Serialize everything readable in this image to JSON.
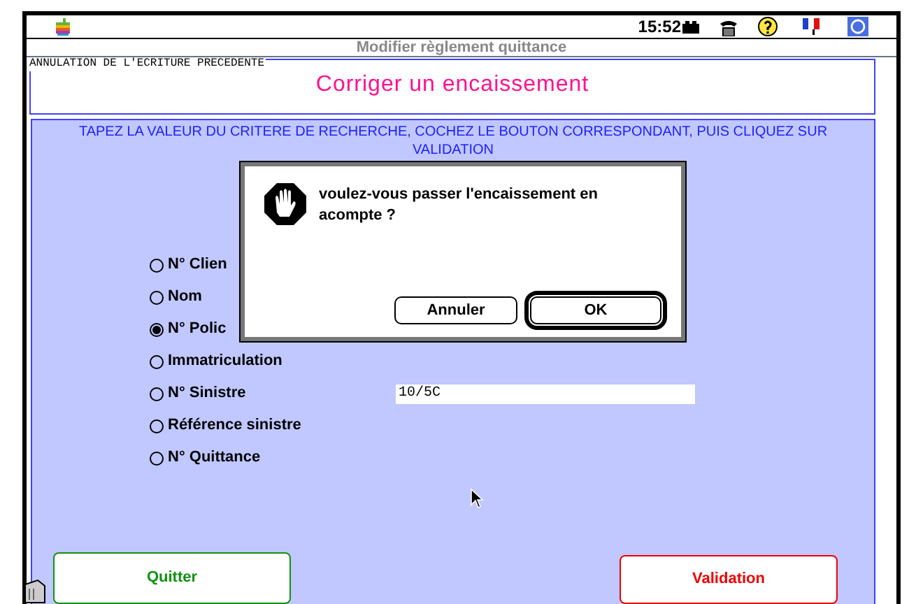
{
  "menu_bar": {
    "time": "15:52"
  },
  "window": {
    "title": "Modifier règlement quittance"
  },
  "header": {
    "caption": "ANNULATION DE L'ECRITURE PRECEDENTE",
    "title": "Corriger un encaissement"
  },
  "instructions": "TAPEZ LA VALEUR DU CRITERE DE RECHERCHE,  COCHEZ LE BOUTON CORRESPONDANT, PUIS CLIQUEZ SUR VALIDATION",
  "criteria": [
    {
      "label": "N° Clien",
      "selected": false
    },
    {
      "label": "Nom",
      "selected": false
    },
    {
      "label": "N° Polic",
      "selected": true
    },
    {
      "label": "Immatriculation",
      "selected": false
    },
    {
      "label": "N° Sinistre",
      "selected": false
    },
    {
      "label": "Référence sinistre",
      "selected": false
    },
    {
      "label": "N° Quittance",
      "selected": false
    }
  ],
  "search_value": "10/5C",
  "buttons": [
    {
      "label": "Quitter",
      "color": "#109010"
    },
    {
      "label": "Validation",
      "color": "#f00000"
    }
  ],
  "alert": {
    "message": "voulez-vous passer l'encaissement en acompte ?",
    "buttons": [
      {
        "label": "Annuler",
        "default": false
      },
      {
        "label": "OK",
        "default": true
      }
    ]
  }
}
